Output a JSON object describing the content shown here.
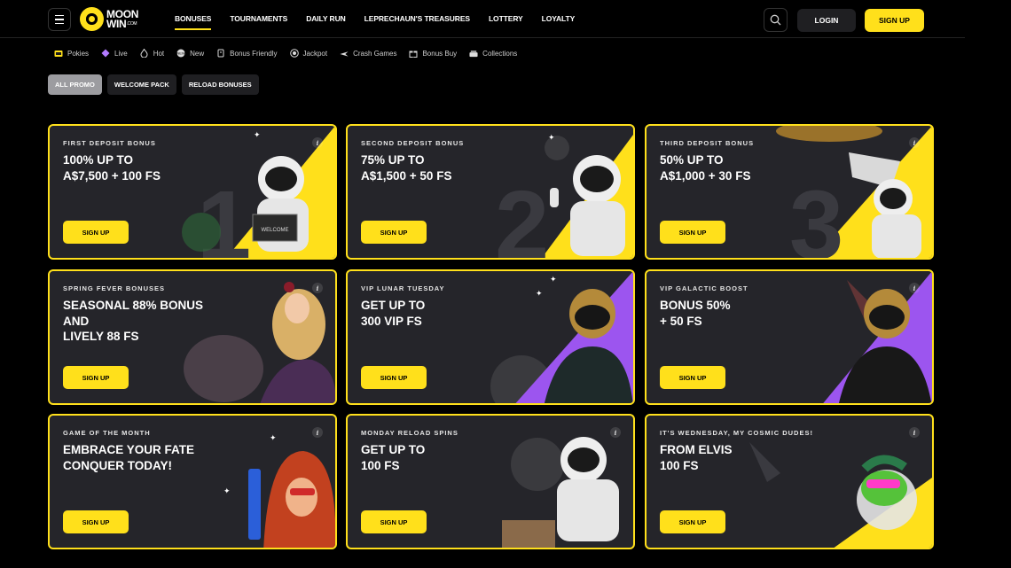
{
  "brand": {
    "name_line1": "MOON",
    "name_line2": "WIN",
    "name_suffix": ".COM",
    "accent": "#ffe01b"
  },
  "header": {
    "nav": [
      "BONUSES",
      "TOURNAMENTS",
      "DAILY RUN",
      "LEPRECHAUN'S TREASURES",
      "LOTTERY",
      "LOYALTY"
    ],
    "login_label": "LOGIN",
    "signup_label": "SIGN UP"
  },
  "categories": [
    {
      "label": "Pokies",
      "icon": "slot-icon"
    },
    {
      "label": "Live",
      "icon": "diamond-icon"
    },
    {
      "label": "Hot",
      "icon": "flame-icon"
    },
    {
      "label": "New",
      "icon": "new-badge-icon"
    },
    {
      "label": "Bonus Friendly",
      "icon": "bonus-icon"
    },
    {
      "label": "Jackpot",
      "icon": "jackpot-icon"
    },
    {
      "label": "Crash Games",
      "icon": "plane-icon"
    },
    {
      "label": "Bonus Buy",
      "icon": "gift-icon"
    },
    {
      "label": "Collections",
      "icon": "collections-icon"
    }
  ],
  "tabs": [
    "ALL PROMO",
    "WELCOME PACK",
    "RELOAD BONUSES"
  ],
  "cards": [
    {
      "subtitle": "FIRST DEPOSIT BONUS",
      "title": "100% UP TO\nA$7,500 + 100 FS",
      "button": "SIGN UP",
      "info": "i",
      "numeral": "1",
      "badge": "WELCOME"
    },
    {
      "subtitle": "SECOND DEPOSIT BONUS",
      "title": "75% UP TO\nA$1,500 + 50 FS",
      "button": "SIGN UP",
      "info": "i",
      "numeral": "2"
    },
    {
      "subtitle": "THIRD DEPOSIT BONUS",
      "title": "50% UP TO\nA$1,000 + 30 FS",
      "button": "SIGN UP",
      "info": "i",
      "numeral": "3"
    },
    {
      "subtitle": "SPRING FEVER BONUSES",
      "title": "SEASONAL 88% BONUS\nAND\nLIVELY 88 FS",
      "button": "SIGN UP",
      "info": "i"
    },
    {
      "subtitle": "VIP LUNAR TUESDAY",
      "title": "GET UP TO\n300 VIP FS",
      "button": "SIGN UP",
      "info": "i"
    },
    {
      "subtitle": "VIP GALACTIC BOOST",
      "title": "BONUS 50%\n+ 50 FS",
      "button": "SIGN UP",
      "info": "i"
    },
    {
      "subtitle": "GAME OF THE MONTH",
      "title": "EMBRACE YOUR FATE\nCONQUER TODAY!",
      "button": "SIGN UP",
      "info": "i"
    },
    {
      "subtitle": "MONDAY RELOAD SPINS",
      "title": "GET UP TO\n100 FS",
      "button": "SIGN UP",
      "info": "i"
    },
    {
      "subtitle": "IT'S WEDNESDAY, MY COSMIC DUDES!",
      "title": "FROM ELVIS\n100 FS",
      "button": "SIGN UP",
      "info": "i"
    }
  ]
}
